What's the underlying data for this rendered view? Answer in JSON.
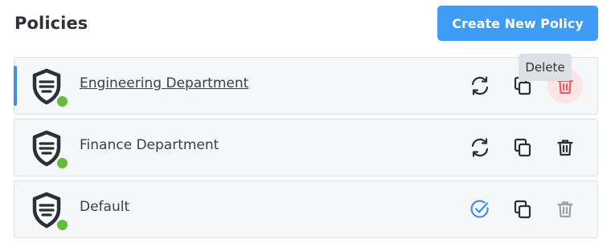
{
  "header": {
    "title": "Policies",
    "create_button_label": "Create New Policy"
  },
  "colors": {
    "primary": "#3f9cf5",
    "active_indicator": "#3f8fe6",
    "status_online": "#62bd3a",
    "delete_hover": "#ef5b5b",
    "disabled_icon": "#9aa0a8"
  },
  "policies": [
    {
      "name": "Engineering Department",
      "status": "online",
      "actions": [
        "sync-icon",
        "copy-icon",
        "trash-icon"
      ],
      "tooltip": "Delete"
    },
    {
      "name": "Finance Department",
      "status": "online",
      "actions": [
        "sync-icon",
        "copy-icon",
        "trash-icon"
      ]
    },
    {
      "name": "Default",
      "status": "online",
      "actions": [
        "check-circle-icon",
        "copy-icon",
        "trash-icon"
      ]
    }
  ]
}
